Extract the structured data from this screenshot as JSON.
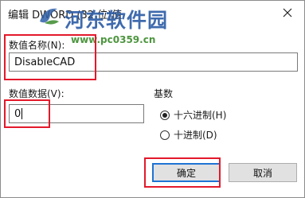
{
  "dialog": {
    "title": "编辑 DWORD (32 位)值"
  },
  "watermark": {
    "title": "河东软件园",
    "url": "www.pc0359.cn"
  },
  "fields": {
    "value_name_label": "数值名称(N):",
    "value_name": "DisableCAD",
    "value_data_label": "数值数据(V):",
    "value_data": "0"
  },
  "base": {
    "label": "基数",
    "hex_label": "十六进制(H)",
    "dec_label": "十进制(D)",
    "selected": "hex"
  },
  "buttons": {
    "ok_label": "确定",
    "cancel_label": "取消"
  },
  "colors": {
    "highlight": "#e3192b",
    "watermark_title": "#2f5fa8",
    "watermark_url": "#3a8a2a",
    "default_button_border": "#1e74d4"
  }
}
